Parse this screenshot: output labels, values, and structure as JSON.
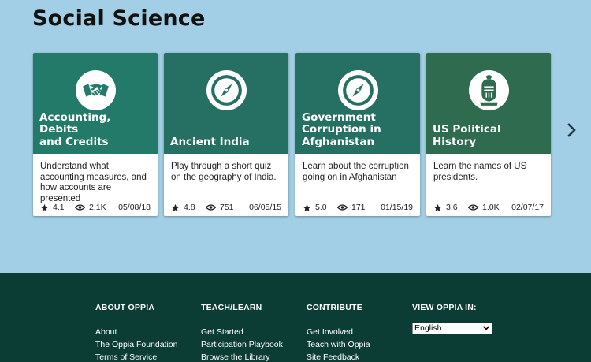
{
  "section": {
    "title": "Social Science"
  },
  "cards": [
    {
      "title_lines": [
        "Accounting, Debits",
        "and Credits"
      ],
      "description": "Understand what accounting measures, and how accounts are presented",
      "rating": "4.1",
      "views": "2.1K",
      "date": "05/08/18",
      "color": "#237a68",
      "icon": "handshake-icon"
    },
    {
      "title_lines": [
        "Ancient India"
      ],
      "description": "Play through a short quiz on the geography of India.",
      "rating": "4.8",
      "views": "751",
      "date": "06/05/15",
      "color": "#266f63",
      "icon": "compass-icon"
    },
    {
      "title_lines": [
        "Government",
        "Corruption in",
        "Afghanistan"
      ],
      "description": "Learn about the corruption going on in Afghanistan",
      "rating": "5.0",
      "views": "171",
      "date": "01/15/19",
      "color": "#266f63",
      "icon": "compass-icon"
    },
    {
      "title_lines": [
        "US Political History"
      ],
      "description": "Learn the names of US presidents.",
      "rating": "3.6",
      "views": "1.0K",
      "date": "02/07/17",
      "color": "#2e6b4f",
      "icon": "knight-helmet-icon"
    }
  ],
  "footer": {
    "about": {
      "heading": "ABOUT OPPIA",
      "links": [
        "About",
        "The Oppia Foundation",
        "Terms of Service"
      ]
    },
    "teach": {
      "heading": "TEACH/LEARN",
      "links": [
        "Get Started",
        "Participation Playbook",
        "Browse the Library"
      ]
    },
    "contribute": {
      "heading": "CONTRIBUTE",
      "links": [
        "Get Involved",
        "Teach with Oppia",
        "Site Feedback"
      ]
    },
    "view": {
      "heading": "VIEW OPPIA IN:",
      "language": "English"
    }
  },
  "colors": {
    "background": "#a2cfe5",
    "footer": "#0b3d34"
  }
}
